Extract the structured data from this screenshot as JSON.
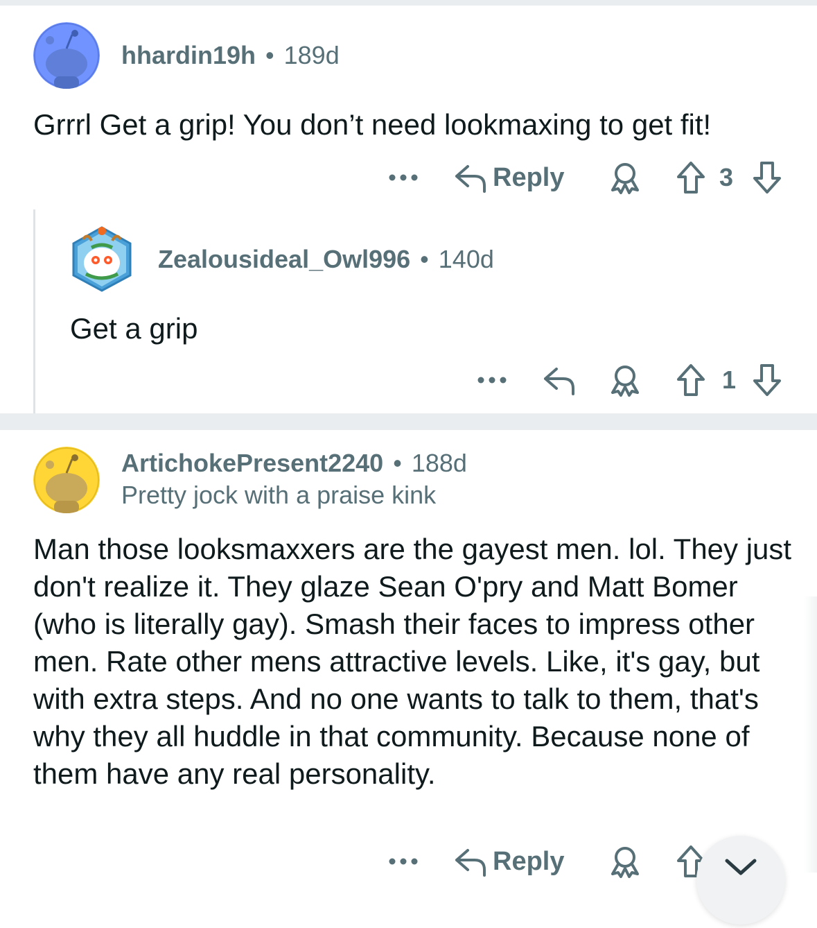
{
  "comments": [
    {
      "username": "hhardin19h",
      "separator": "•",
      "age": "189d",
      "body": "Grrrl Get a grip! You don’t need lookmaxing to get fit!",
      "actions": {
        "more": "•••",
        "reply_label": "Reply",
        "score": "3"
      },
      "avatar_color": "#7193ff"
    },
    {
      "username": "Zealousideal_Owl996",
      "separator": "•",
      "age": "140d",
      "body": "Get a grip",
      "actions": {
        "more": "•••",
        "score": "1"
      }
    },
    {
      "username": "ArtichokePresent2240",
      "separator": "•",
      "age": "188d",
      "flair": "Pretty jock with a praise kink",
      "body": "Man those looksmaxxers are the gayest men. lol. They just don't realize it. They glaze Sean O'pry and Matt Bomer (who is literally gay). Smash their faces to impress other men. Rate other mens attractive levels. Like, it's gay, but with extra steps. And no one wants to talk to them, that's why they all huddle in that community. Because none of them have any real personality.",
      "actions": {
        "more": "•••",
        "reply_label": "Reply"
      },
      "avatar_color": "#ffd635"
    }
  ],
  "colors": {
    "meta_gray": "#576f76",
    "text": "#0f1a1c",
    "separator_bg": "#eaedef"
  },
  "icons": [
    "more-icon",
    "reply-icon",
    "award-icon",
    "upvote-icon",
    "downvote-icon",
    "collapse-chevron-icon"
  ]
}
